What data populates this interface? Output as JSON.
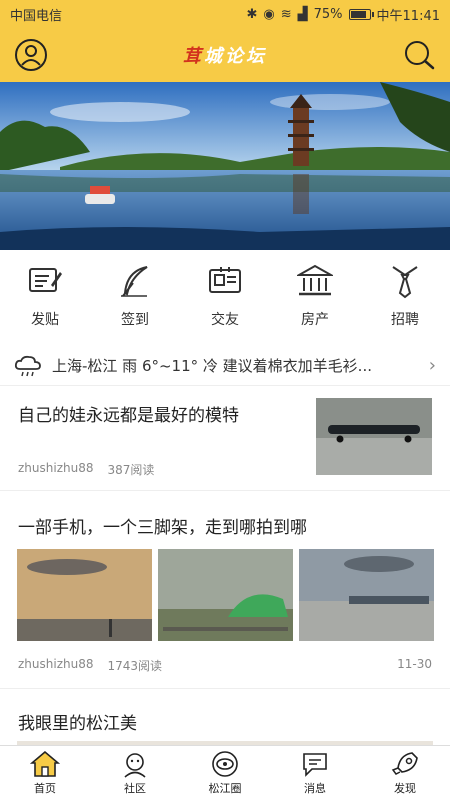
{
  "status": {
    "carrier": "中国电信",
    "battery": "75%",
    "battery_level": 0.75,
    "time": "中午11:41"
  },
  "header": {
    "logo_first": "茸",
    "logo_rest": "城论坛"
  },
  "quicknav": [
    {
      "label": "发贴",
      "icon": "post-icon"
    },
    {
      "label": "签到",
      "icon": "feather-icon"
    },
    {
      "label": "交友",
      "icon": "id-card-icon"
    },
    {
      "label": "房产",
      "icon": "building-icon"
    },
    {
      "label": "招聘",
      "icon": "tie-icon"
    }
  ],
  "weather": {
    "text": "上海-松江 雨 6°~11° 冷 建议着棉衣加羊毛衫...",
    "icon": "cloud-rain-icon"
  },
  "posts": [
    {
      "title": "自己的娃永远都是最好的模特",
      "author": "zhushizhu88",
      "reads": "387阅读"
    },
    {
      "title": "一部手机，一个三脚架，走到哪拍到哪",
      "author": "zhushizhu88",
      "reads": "1743阅读",
      "date": "11-30"
    },
    {
      "title": "我眼里的松江美"
    }
  ],
  "tabs": [
    {
      "label": "首页",
      "icon": "home-icon",
      "active": true
    },
    {
      "label": "社区",
      "icon": "community-icon"
    },
    {
      "label": "松江圈",
      "icon": "circle-eye-icon"
    },
    {
      "label": "消息",
      "icon": "message-icon"
    },
    {
      "label": "发现",
      "icon": "rocket-icon"
    }
  ],
  "colors": {
    "accent": "#f7cb46",
    "logo_red": "#d2321e"
  }
}
